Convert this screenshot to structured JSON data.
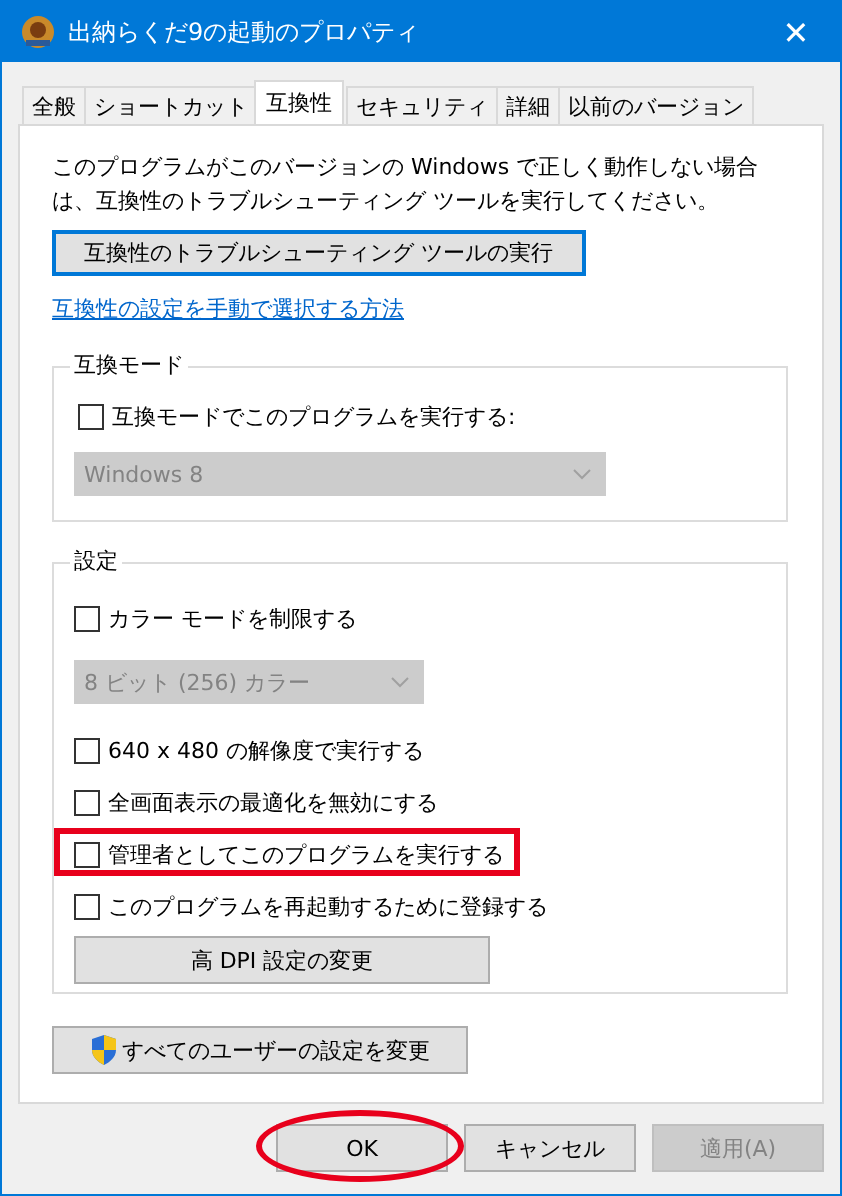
{
  "window": {
    "title": "出納らくだ9の起動のプロパティ",
    "close": "✕"
  },
  "tabs": [
    {
      "label": "全般",
      "selected": false
    },
    {
      "label": "ショートカット",
      "selected": false
    },
    {
      "label": "互換性",
      "selected": true
    },
    {
      "label": "セキュリティ",
      "selected": false
    },
    {
      "label": "詳細",
      "selected": false
    },
    {
      "label": "以前のバージョン",
      "selected": false
    }
  ],
  "intro": "このプログラムがこのバージョンの Windows で正しく動作しない場合は、互換性のトラブルシューティング ツールを実行してください。",
  "troubleshoot_button": {
    "label": "互換性のトラブルシューティング ツールの実行",
    "focused": true
  },
  "help_link": "互換性の設定を手動で選択する方法",
  "compat_group": {
    "title": "互換モード",
    "checkbox": {
      "label": "互換モードでこのプログラムを実行する:",
      "checked": false
    },
    "dropdown": {
      "value": "Windows 8",
      "disabled": true
    }
  },
  "settings_group": {
    "title": "設定",
    "items": [
      {
        "kind": "checkbox",
        "label": "カラー モードを制限する",
        "checked": false,
        "highlighted": false
      },
      {
        "kind": "dropdown",
        "value": "8 ビット (256) カラー",
        "disabled": true
      },
      {
        "kind": "checkbox",
        "label": "640 x 480 の解像度で実行する",
        "checked": false,
        "highlighted": false
      },
      {
        "kind": "checkbox",
        "label": "全画面表示の最適化を無効にする",
        "checked": false,
        "highlighted": false
      },
      {
        "kind": "checkbox",
        "label": "管理者としてこのプログラムを実行する",
        "checked": false,
        "highlighted": true
      },
      {
        "kind": "checkbox",
        "label": "このプログラムを再起動するために登録する",
        "checked": false,
        "highlighted": false
      },
      {
        "kind": "button",
        "label": "高 DPI 設定の変更"
      }
    ]
  },
  "all_users_button": "すべてのユーザーの設定を変更",
  "buttons": [
    {
      "label": "OK",
      "disabled": false,
      "circled": true
    },
    {
      "label": "キャンセル",
      "disabled": false,
      "circled": false
    },
    {
      "label": "適用(A)",
      "disabled": true,
      "circled": false
    }
  ]
}
